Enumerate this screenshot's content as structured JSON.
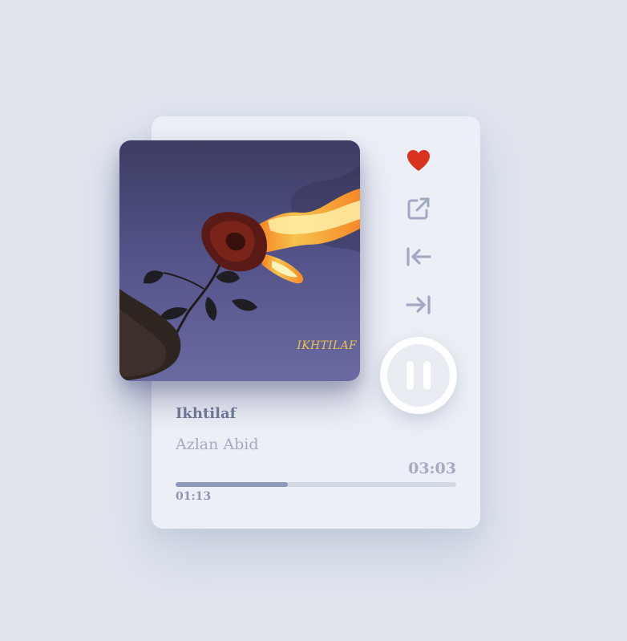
{
  "track": {
    "title": "Ikhtilaf",
    "artist": "Azlan Abid",
    "cover_text": "IKHTILAF",
    "duration": "03:03",
    "current_time": "01:13",
    "progress": 0.4
  },
  "controls": {
    "favorite_icon": "heart-icon",
    "share_icon": "external-link-icon",
    "previous_icon": "skip-back-icon",
    "next_icon": "skip-forward-icon",
    "play_state_icon": "pause-icon",
    "favorited": true
  },
  "colors": {
    "background": "#dfe4ed",
    "card": "#eceff5",
    "heart": "#d9321f",
    "icon": "#a1a8c2",
    "progress_track": "#d2d7e4",
    "progress_fill": "#8f99b9",
    "title": "#6c7594",
    "subtitle": "#a5acc1",
    "cover_text": "#e9c24a"
  }
}
